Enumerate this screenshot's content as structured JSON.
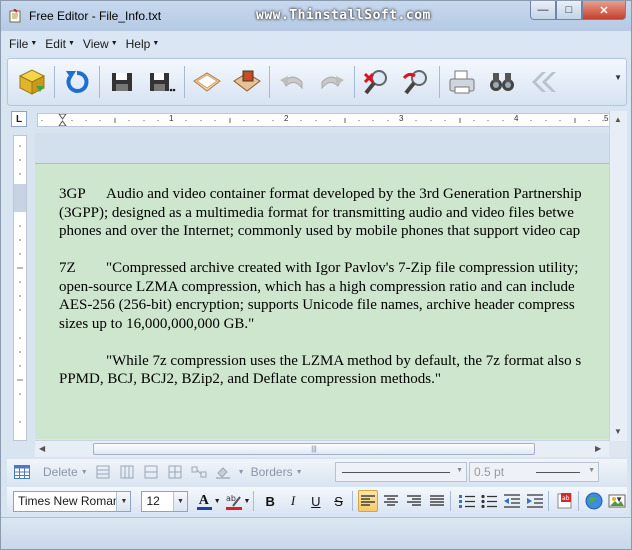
{
  "window": {
    "title": "Free Editor - File_Info.txt",
    "promo": "www.ThinstallSoft.com",
    "controls": {
      "minimize": "—",
      "maximize": "□",
      "close": "✕"
    }
  },
  "menu": [
    {
      "label": "File"
    },
    {
      "label": "Edit"
    },
    {
      "label": "View"
    },
    {
      "label": "Help"
    }
  ],
  "toolbar": {
    "buttons": [
      "new-document",
      "refresh",
      "save",
      "save-as",
      "open",
      "open-file",
      "undo",
      "redo",
      "find",
      "replace",
      "print",
      "find-next",
      "back"
    ]
  },
  "ruler": {
    "corner": "L",
    "marks": [
      "1",
      "2",
      "3",
      "4",
      "5"
    ]
  },
  "document": {
    "paragraphs": [
      {
        "lines": [
          {
            "tab": "3GP",
            "text": "Audio and video container format developed by the 3rd Generation Partnership"
          },
          {
            "text": "(3GPP); designed as a multimedia format for transmitting audio and video files betwe"
          },
          {
            "text": "phones and over the Internet; commonly used by mobile phones that support video cap"
          }
        ]
      },
      {
        "lines": [
          {
            "tab": "7Z",
            "text": "\"Compressed archive created with Igor Pavlov's 7-Zip file compression utility;"
          },
          {
            "text": "open-source LZMA compression, which has a high compression ratio and can include"
          },
          {
            "text": "AES-256 (256-bit) encryption; supports Unicode file names, archive header compress"
          },
          {
            "text": "sizes up to 16,000,000,000 GB.\""
          }
        ]
      },
      {
        "lines": [
          {
            "indent": true,
            "text": "\"While 7z compression uses the LZMA method by default, the 7z format also s"
          },
          {
            "text": "PPMD, BCJ, BCJ2, BZip2, and Deflate compression methods.\""
          }
        ]
      }
    ]
  },
  "table_bar": {
    "delete_label": "Delete",
    "borders_label": "Borders",
    "width_value": "0.5 pt"
  },
  "format_bar": {
    "font": "Times New Roman",
    "size": "12",
    "bold": "B",
    "italic": "I",
    "underline": "U",
    "strike": "S",
    "alignment_selected": "left"
  },
  "colors": {
    "page_background": "#cde6cd",
    "font_color_bar": "#1f3fa0",
    "highlight_bar": "#e02020"
  }
}
